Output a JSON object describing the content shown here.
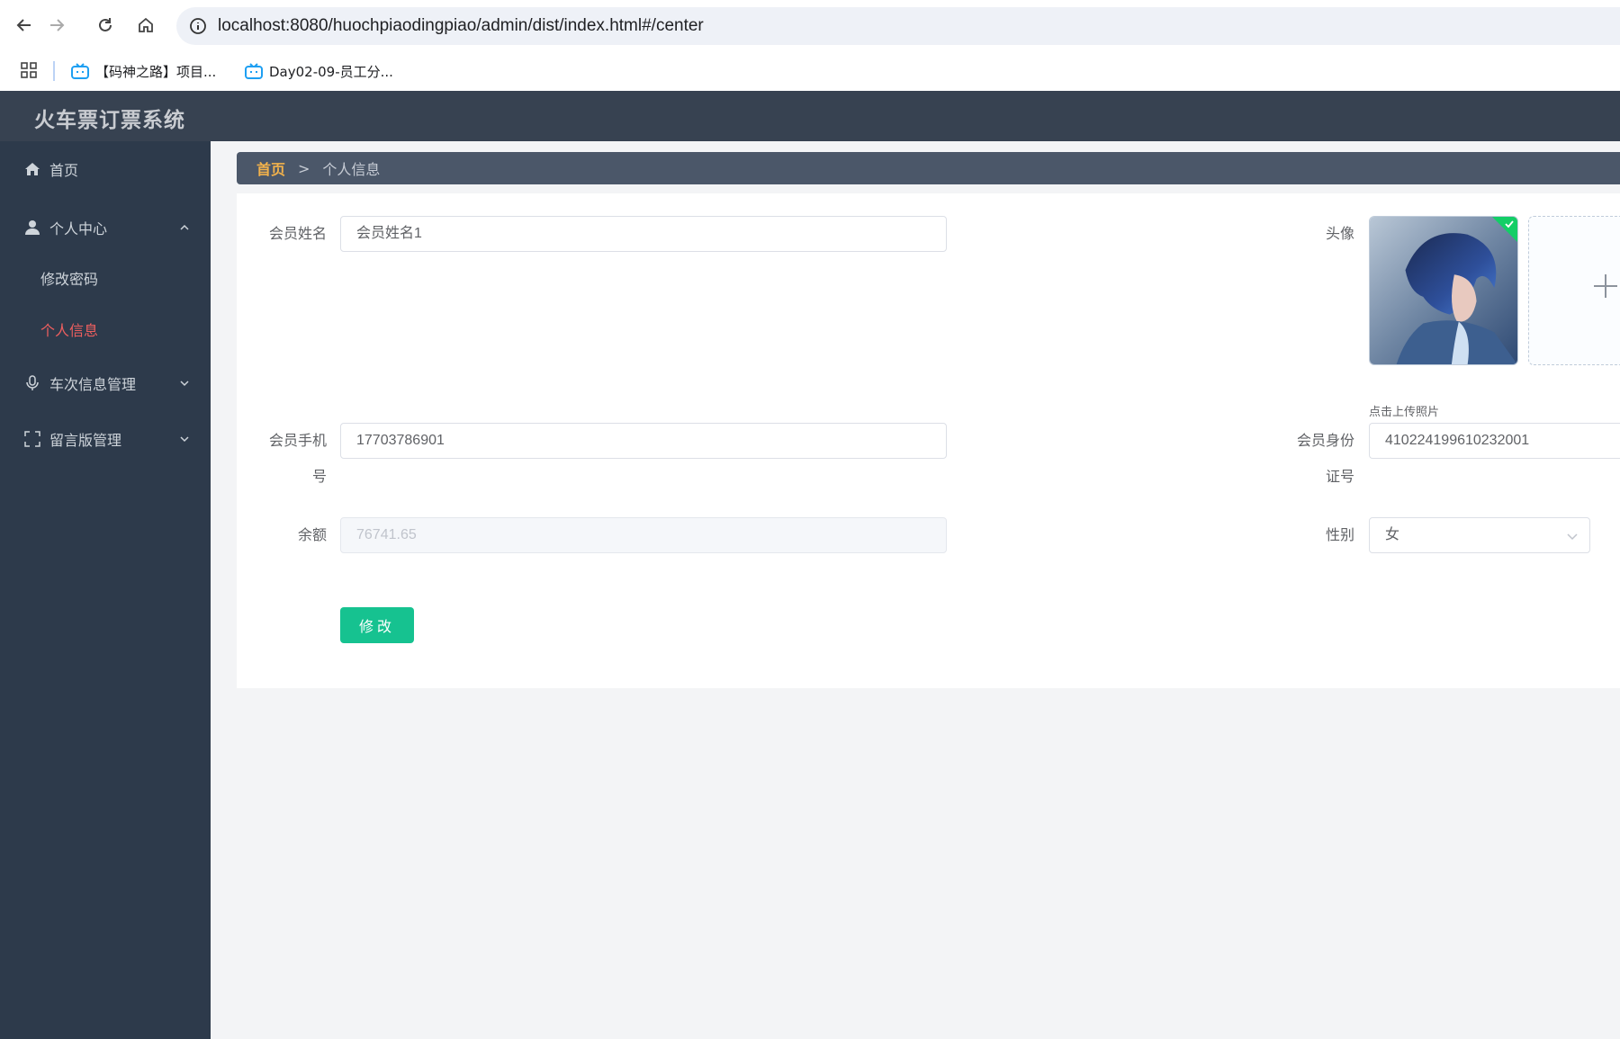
{
  "browser": {
    "url": "localhost:8080/huochpiaodingpiao/admin/dist/index.html#/center",
    "bookmarks": [
      {
        "label": "【码神之路】项目..."
      },
      {
        "label": "Day02-09-员工分..."
      }
    ]
  },
  "app": {
    "title": "火车票订票系统"
  },
  "sidebar": {
    "items": [
      {
        "label": "首页",
        "icon": "home-icon"
      },
      {
        "label": "个人中心",
        "icon": "user-icon",
        "expanded": true
      },
      {
        "label": "车次信息管理",
        "icon": "microphone-icon",
        "expanded": false
      },
      {
        "label": "留言版管理",
        "icon": "fullscreen-icon",
        "expanded": false
      }
    ],
    "submenu": [
      {
        "label": "修改密码"
      },
      {
        "label": "个人信息",
        "active": true
      }
    ]
  },
  "breadcrumb": {
    "home": "首页",
    "separator": ">",
    "current": "个人信息"
  },
  "form": {
    "name_label": "会员姓名",
    "name_value": "会员姓名1",
    "avatar_label": "头像",
    "upload_tip": "点击上传照片",
    "phone_label_line1": "会员手机",
    "phone_label_line2": "号",
    "phone_value": "17703786901",
    "idcard_label_line1": "会员身份",
    "idcard_label_line2": "证号",
    "idcard_value": "410224199610232001",
    "balance_label": "余额",
    "balance_value": "76741.65",
    "gender_label": "性别",
    "gender_value": "女",
    "submit_label": "修改"
  },
  "colors": {
    "header_bg": "#374251",
    "sidebar_bg": "#2d3a4b",
    "active_menu": "#ef5f5f",
    "breadcrumb_home": "#f2b24b",
    "submit_button": "#16c290"
  }
}
